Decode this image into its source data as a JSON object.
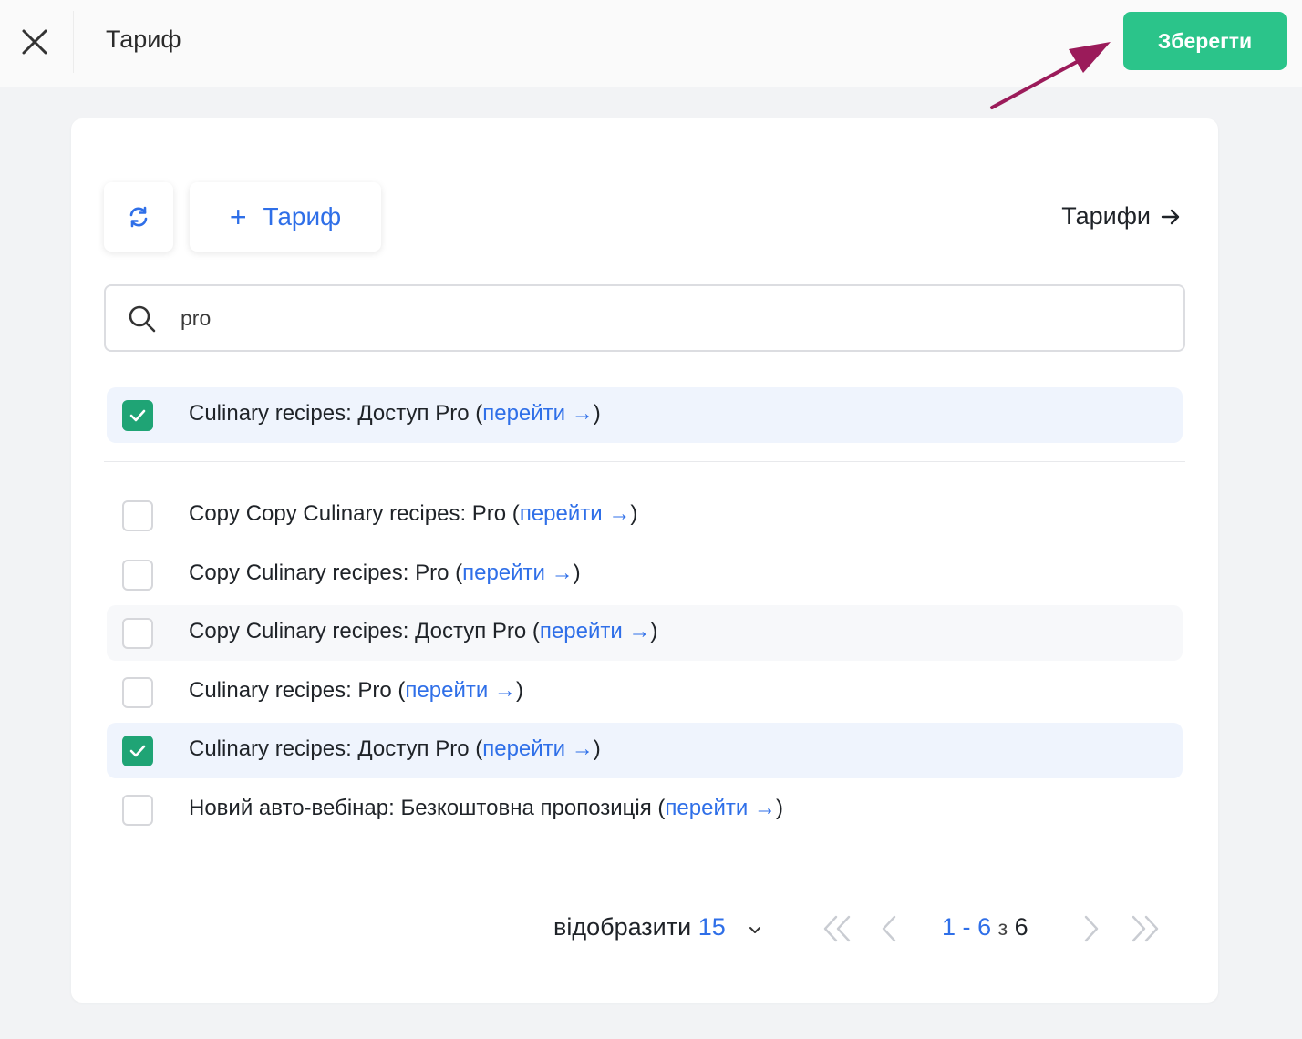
{
  "header": {
    "title": "Тариф",
    "save_label": "Зберегти"
  },
  "toolbar": {
    "add_label": "Тариф",
    "tariffs_link": "Тарифи"
  },
  "search": {
    "value": "pro"
  },
  "pinned": {
    "label": "Culinary recipes: Доступ Pro (",
    "link": "перейти",
    "close": ")",
    "checked": true
  },
  "list": [
    {
      "label": "Copy Copy Culinary recipes: Pro (",
      "link": "перейти",
      "close": ")",
      "checked": false
    },
    {
      "label": "Copy Culinary recipes: Pro (",
      "link": "перейти",
      "close": ")",
      "checked": false
    },
    {
      "label": "Copy Culinary recipes: Доступ Pro (",
      "link": "перейти",
      "close": ")",
      "checked": false
    },
    {
      "label": "Culinary recipes: Pro (",
      "link": "перейти",
      "close": ")",
      "checked": false
    },
    {
      "label": "Culinary recipes: Доступ Pro (",
      "link": "перейти",
      "close": ")",
      "checked": true
    },
    {
      "label": "Новий авто-вебінар: Безкоштовна пропозиція (",
      "link": "перейти",
      "close": ")",
      "checked": false
    }
  ],
  "pagination": {
    "show_label": "відобразити",
    "per_page": "15",
    "range_start": "1",
    "range_sep": "-",
    "range_end": "6",
    "of_label": "з",
    "total": "6"
  },
  "colors": {
    "accent": "#2f6fe8",
    "save": "#2bc48a",
    "check": "#1fa475",
    "annotation": "#9b1b5a"
  }
}
